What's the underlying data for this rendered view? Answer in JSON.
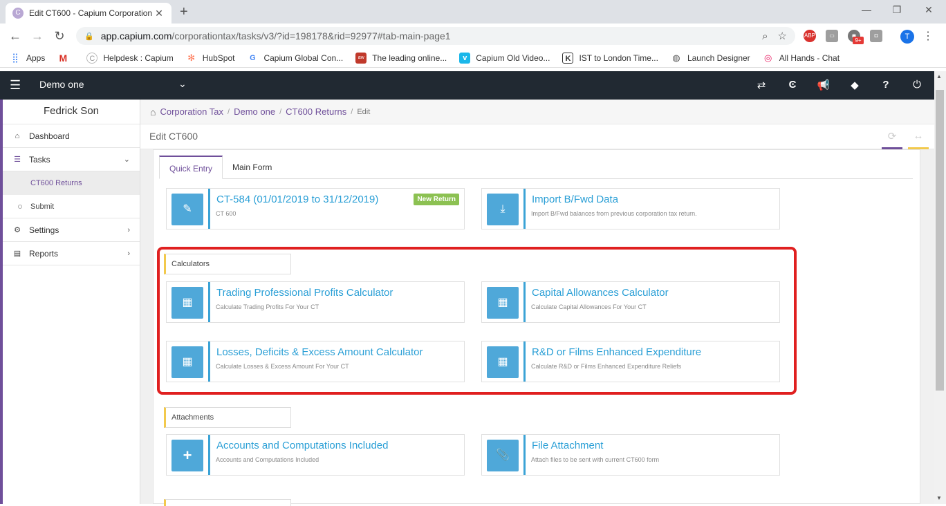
{
  "browser": {
    "tab_title": "Edit CT600 - Capium Corporation",
    "url_host": "app.capium.com",
    "url_path": "/corporationtax/tasks/v3/?id=198178&rid=92977#tab-main-page1",
    "profile_initial": "T",
    "ext_badge": "9+",
    "bookmarks": [
      {
        "label": "Apps"
      },
      {
        "label": ""
      },
      {
        "label": "Helpdesk : Capium"
      },
      {
        "label": "HubSpot"
      },
      {
        "label": "Capium Global Con..."
      },
      {
        "label": "The leading online..."
      },
      {
        "label": "Capium Old Video..."
      },
      {
        "label": "IST to London Time..."
      },
      {
        "label": "Launch Designer"
      },
      {
        "label": "All Hands - Chat"
      }
    ]
  },
  "header": {
    "client_name": "Demo one"
  },
  "sidebar": {
    "user_name": "Fedrick Son",
    "items": [
      {
        "label": "Dashboard"
      },
      {
        "label": "Tasks"
      },
      {
        "label": "CT600 Returns"
      },
      {
        "label": "Submit"
      },
      {
        "label": "Settings"
      },
      {
        "label": "Reports"
      }
    ]
  },
  "breadcrumb": {
    "items": [
      "Corporation Tax",
      "Demo one",
      "CT600 Returns",
      "Edit"
    ]
  },
  "page": {
    "title": "Edit CT600",
    "tabs": [
      "Quick Entry",
      "Main Form"
    ]
  },
  "cards": {
    "return_card": {
      "title": "CT-584 (01/01/2019 to 31/12/2019)",
      "subtitle": "CT 600",
      "badge": "New Return"
    },
    "import_card": {
      "title": "Import B/Fwd Data",
      "subtitle": "Import B/Fwd balances from previous corporation tax return."
    },
    "calculators_label": "Calculators",
    "trading": {
      "title": "Trading Professional Profits Calculator",
      "subtitle": "Calculate Trading Profits For Your CT"
    },
    "capital": {
      "title": "Capital Allowances Calculator",
      "subtitle": "Calculate Capital Allowances For Your CT"
    },
    "losses": {
      "title": "Losses, Deficits & Excess Amount Calculator",
      "subtitle": "Calculate Losses & Excess Amount For Your CT"
    },
    "rnd": {
      "title": "R&D or Films Enhanced Expenditure",
      "subtitle": "Calculate R&D or Films Enhanced Expenditure Reliefs"
    },
    "attachments_label": "Attachments",
    "accounts": {
      "title": "Accounts and Computations Included",
      "subtitle": "Accounts and Computations Included"
    },
    "file": {
      "title": "File Attachment",
      "subtitle": "Attach files to be sent with current CT600 form"
    }
  },
  "colors": {
    "accent_purple": "#6f4f9a",
    "card_blue": "#4fa8d9",
    "highlight_red": "#e02020",
    "badge_green": "#8cc152",
    "header_dark": "#212932"
  }
}
